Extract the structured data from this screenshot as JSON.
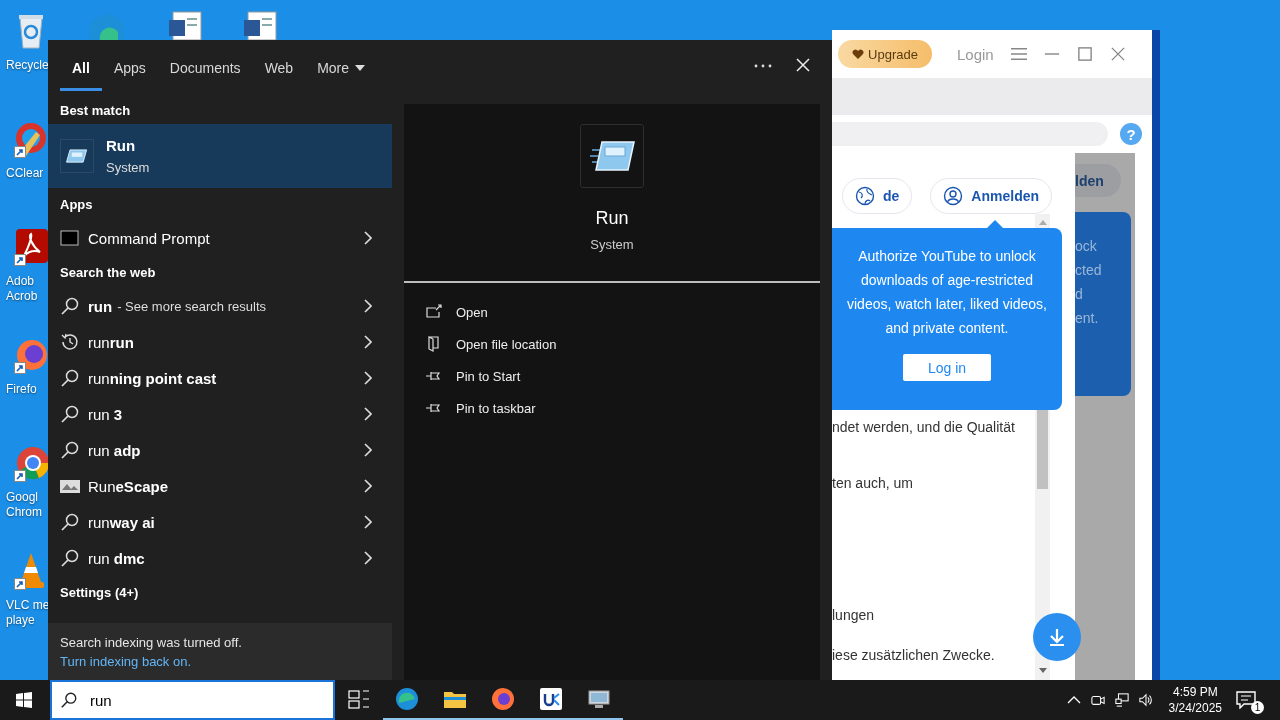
{
  "desktop": {
    "icons": [
      {
        "kind": "recycle",
        "lines": [
          "Recycle"
        ],
        "shortcut": false
      },
      {
        "kind": "ccleaner",
        "lines": [
          "CClear"
        ],
        "shortcut": true
      },
      {
        "kind": "acrobat",
        "lines": [
          "Adob",
          "Acrob"
        ],
        "shortcut": true
      },
      {
        "kind": "firefox",
        "lines": [
          "Firefo"
        ],
        "shortcut": true
      },
      {
        "kind": "chrome",
        "lines": [
          "Googl",
          "Chrom"
        ],
        "shortcut": true
      },
      {
        "kind": "vlc",
        "lines": [
          "VLC me",
          "playe"
        ],
        "shortcut": true
      }
    ],
    "top_icons": [
      {
        "kind": "edge"
      },
      {
        "kind": "document"
      },
      {
        "kind": "document"
      }
    ]
  },
  "search_panel": {
    "tabs": [
      {
        "label": "All",
        "selected": true,
        "kind": "tab"
      },
      {
        "label": "Apps",
        "selected": false,
        "kind": "tab"
      },
      {
        "label": "Documents",
        "selected": false,
        "kind": "tab"
      },
      {
        "label": "Web",
        "selected": false,
        "kind": "tab"
      },
      {
        "label": "More",
        "selected": false,
        "kind": "dropdown"
      }
    ],
    "results": [
      {
        "kind": "header",
        "label": "Best match"
      },
      {
        "kind": "best",
        "title": "Run",
        "subtitle": "System",
        "selected": true
      },
      {
        "kind": "header",
        "label": "Apps"
      },
      {
        "kind": "app",
        "title": "Command Prompt"
      },
      {
        "kind": "header",
        "label": "Search the web"
      },
      {
        "kind": "web",
        "title": "**run**",
        "note": "- See more search results"
      },
      {
        "kind": "history",
        "title": "run**run**"
      },
      {
        "kind": "web",
        "title": "run**ning point cast**"
      },
      {
        "kind": "web",
        "title": "run **3**"
      },
      {
        "kind": "web",
        "title": "run **adp**"
      },
      {
        "kind": "site",
        "title": "Run**eScape**"
      },
      {
        "kind": "web",
        "title": "run**way ai**"
      },
      {
        "kind": "web",
        "title": "run **dmc**"
      },
      {
        "kind": "header",
        "label": "Settings (4+)"
      }
    ],
    "footer": {
      "text": "Search indexing was turned off.",
      "link": "Turn indexing back on."
    },
    "preview": {
      "title": "Run",
      "subtitle": "System",
      "actions": [
        {
          "kind": "open",
          "label": "Open"
        },
        {
          "kind": "folder",
          "label": "Open file location"
        },
        {
          "kind": "pin",
          "label": "Pin to Start"
        },
        {
          "kind": "pin",
          "label": "Pin to taskbar"
        }
      ]
    }
  },
  "app_window": {
    "upgrade": "Upgrade",
    "login": "Login",
    "help": "?",
    "language": "de",
    "sign_in": "Anmelden",
    "overlay": {
      "button": "lden",
      "lines": [
        "ock",
        "cted",
        "d",
        "ent."
      ]
    },
    "tooltip": {
      "text": "Authorize YouTube to unlock downloads of age-restricted videos, watch later, liked videos, and private content.",
      "button": "Log in"
    },
    "body_lines": [
      "ndet werden, und die Qualität",
      "ten auch, um",
      "lungen",
      "iese zusätzlichen Zwecke."
    ]
  },
  "taskbar": {
    "search_value": "run",
    "apps": [
      {
        "kind": "task-view",
        "running": false
      },
      {
        "kind": "edge",
        "running": true
      },
      {
        "kind": "explorer",
        "running": true
      },
      {
        "kind": "firefox",
        "running": true
      },
      {
        "kind": "app",
        "running": true
      },
      {
        "kind": "monitor",
        "running": true
      }
    ],
    "time": "4:59 PM",
    "date": "3/24/2025",
    "notifications": "1"
  }
}
